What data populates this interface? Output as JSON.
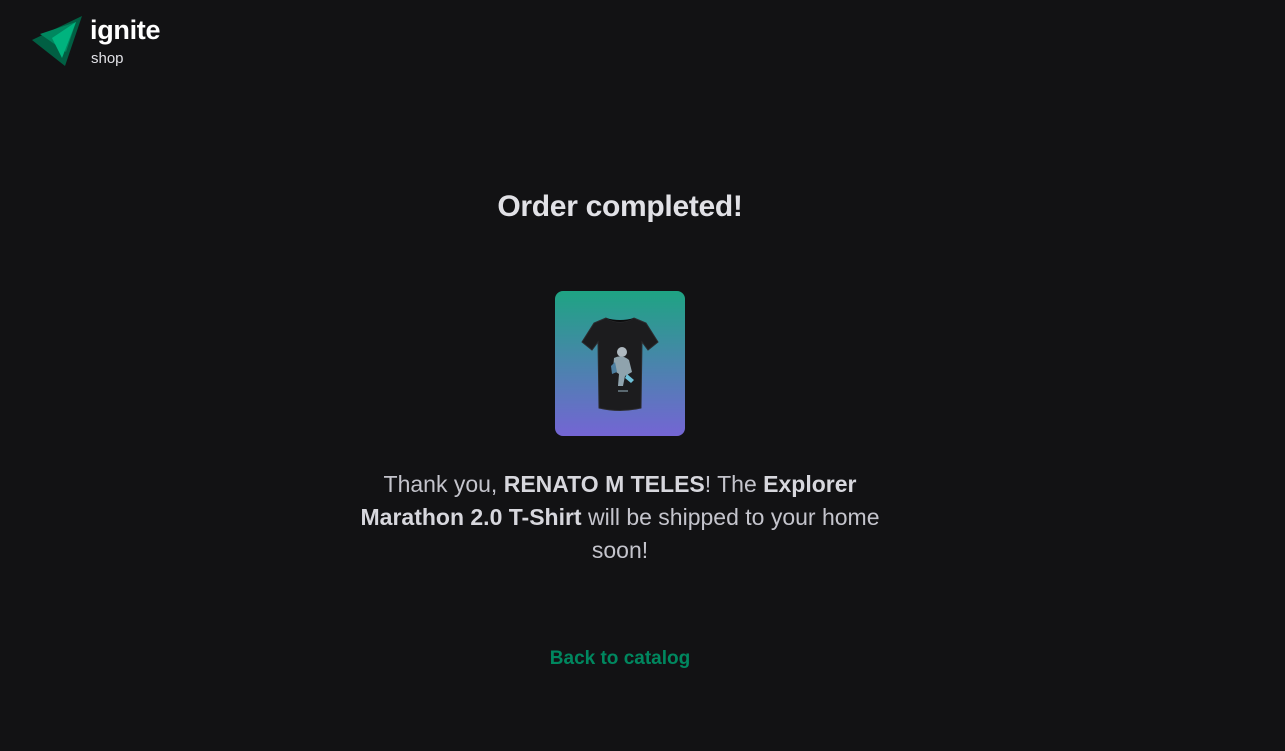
{
  "header": {
    "logo_name": "ignite",
    "logo_sub": "shop",
    "logo_icon": "ignite-triangle-logo"
  },
  "main": {
    "title": "Order completed!",
    "product_image_icon": "tshirt-icon",
    "message": {
      "prefix": "Thank you, ",
      "customer_name": "RENATO M TELES",
      "middle": "! The ",
      "product_name": "Explorer Marathon 2.0 T-Shirt",
      "suffix": " will be shipped to your home soon!"
    },
    "back_link_label": "Back to catalog"
  },
  "colors": {
    "background": "#121214",
    "brand_green": "#00875f",
    "gradient_top": "#1ea483",
    "gradient_bottom": "#7465d4",
    "title_text": "#e1e1e6",
    "body_text": "#c4c4cc"
  }
}
